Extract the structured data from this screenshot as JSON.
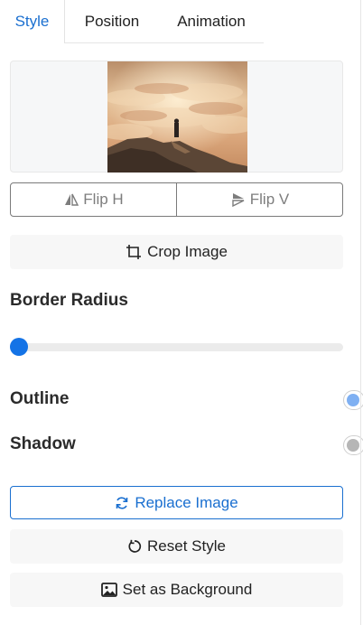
{
  "tabs": {
    "style": "Style",
    "position": "Position",
    "animation": "Animation"
  },
  "buttons": {
    "flip_h": "Flip H",
    "flip_v": "Flip V",
    "crop": "Crop Image",
    "replace": "Replace Image",
    "reset": "Reset Style",
    "set_background": "Set as Background"
  },
  "sections": {
    "border_radius": "Border Radius",
    "outline": "Outline",
    "shadow": "Shadow"
  },
  "controls": {
    "border_radius_value": 0,
    "outline_on": true,
    "shadow_on": false
  },
  "colors": {
    "accent": "#1a6fd0",
    "slider_thumb": "#1473e6",
    "outline_knob": "#7fb0f2",
    "shadow_knob": "#b6b6b6"
  },
  "icons": {
    "flip_h": "flip-horizontal-icon",
    "flip_v": "flip-vertical-icon",
    "crop": "crop-icon",
    "replace": "refresh-icon",
    "reset": "reset-icon",
    "set_background": "image-icon"
  }
}
